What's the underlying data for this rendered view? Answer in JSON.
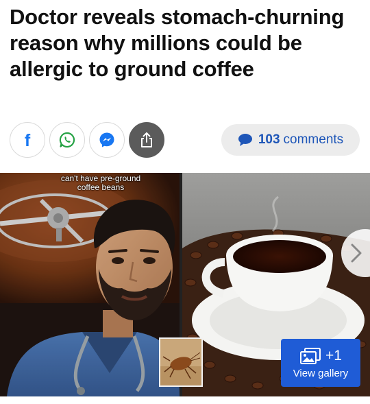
{
  "article": {
    "headline": "Doctor reveals stomach-churning reason why millions could be allergic to ground coffee"
  },
  "share": {
    "facebook_letter": "f",
    "buttons": [
      {
        "icon": "facebook-icon"
      },
      {
        "icon": "whatsapp-icon"
      },
      {
        "icon": "messenger-icon"
      },
      {
        "icon": "share-icon"
      }
    ]
  },
  "comments": {
    "count": "103",
    "label": "comments",
    "icon": "speech-bubble-icon",
    "color": "#1e56b8"
  },
  "gallery": {
    "video_caption_line1": "can't have pre-ground",
    "video_caption_line2": "coffee beans",
    "extra_count": "+1",
    "view_label": "View gallery",
    "accent_color": "#1f5cd6"
  }
}
